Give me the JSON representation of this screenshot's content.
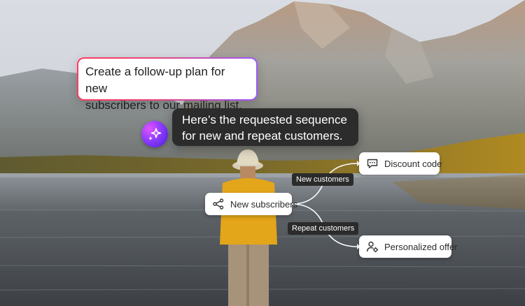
{
  "prompt": {
    "line1": "Create a follow-up plan for new",
    "line2": "subscribers to our mailing list."
  },
  "response": {
    "avatar_icon": "sparkle-icon",
    "line1": "Here’s the requested sequence",
    "line2": "for new and repeat customers."
  },
  "flow": {
    "root": {
      "label": "New subscribers",
      "icon": "share-icon"
    },
    "branches": [
      {
        "edge_label": "New customers",
        "target": "Discount code",
        "icon": "comment-icon"
      },
      {
        "edge_label": "Repeat customers",
        "target": "Personalized offer",
        "icon": "user-settings-icon"
      }
    ]
  },
  "colors": {
    "prompt_border_start": "#ff3b5f",
    "prompt_border_end": "#9b59ff",
    "response_bg": "#2c2c2c",
    "avatar_gradient": "#8e3bff"
  }
}
